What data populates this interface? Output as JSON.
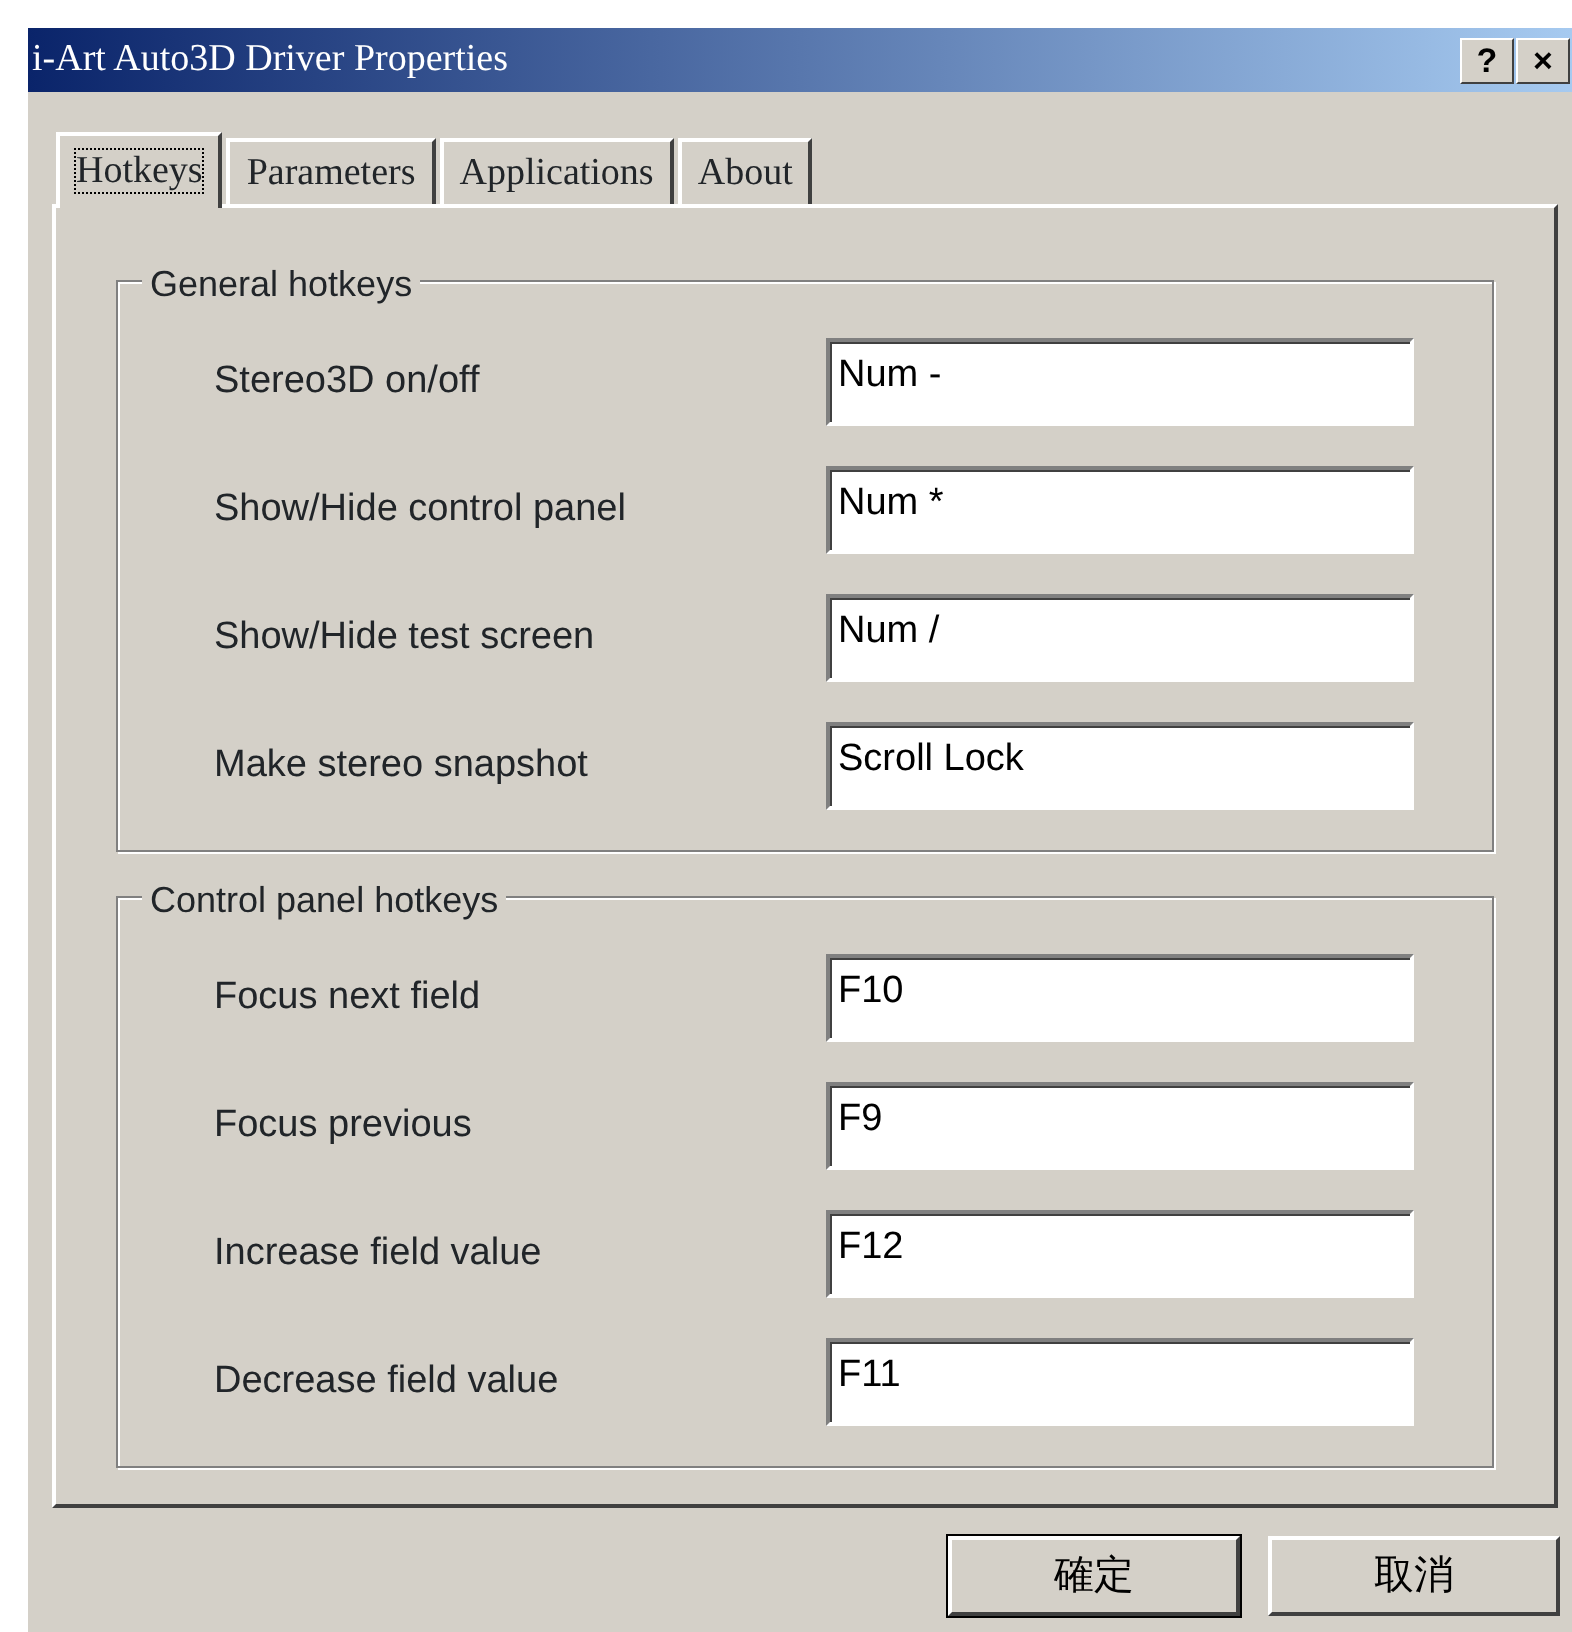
{
  "window": {
    "title": "i-Art Auto3D Driver Properties",
    "title_buttons": [
      "?",
      "×"
    ]
  },
  "tabs": [
    {
      "label": "Hotkeys",
      "selected": true
    },
    {
      "label": "Parameters",
      "selected": false
    },
    {
      "label": "Applications",
      "selected": false
    },
    {
      "label": "About",
      "selected": false
    }
  ],
  "groups": [
    {
      "title": "General hotkeys",
      "rows": [
        {
          "label": "Stereo3D on/off",
          "value": "Num -"
        },
        {
          "label": "Show/Hide control panel",
          "value": "Num *"
        },
        {
          "label": "Show/Hide test screen",
          "value": "Num /"
        },
        {
          "label": "Make stereo snapshot",
          "value": "Scroll Lock"
        }
      ]
    },
    {
      "title": "Control panel hotkeys",
      "rows": [
        {
          "label": "Focus next field",
          "value": "F10"
        },
        {
          "label": "Focus previous",
          "value": "F9"
        },
        {
          "label": "Increase field value",
          "value": "F12"
        },
        {
          "label": "Decrease field value",
          "value": "F11"
        }
      ]
    }
  ],
  "buttons": [
    {
      "label": "確定",
      "default": true
    },
    {
      "label": "取消",
      "default": false
    }
  ]
}
